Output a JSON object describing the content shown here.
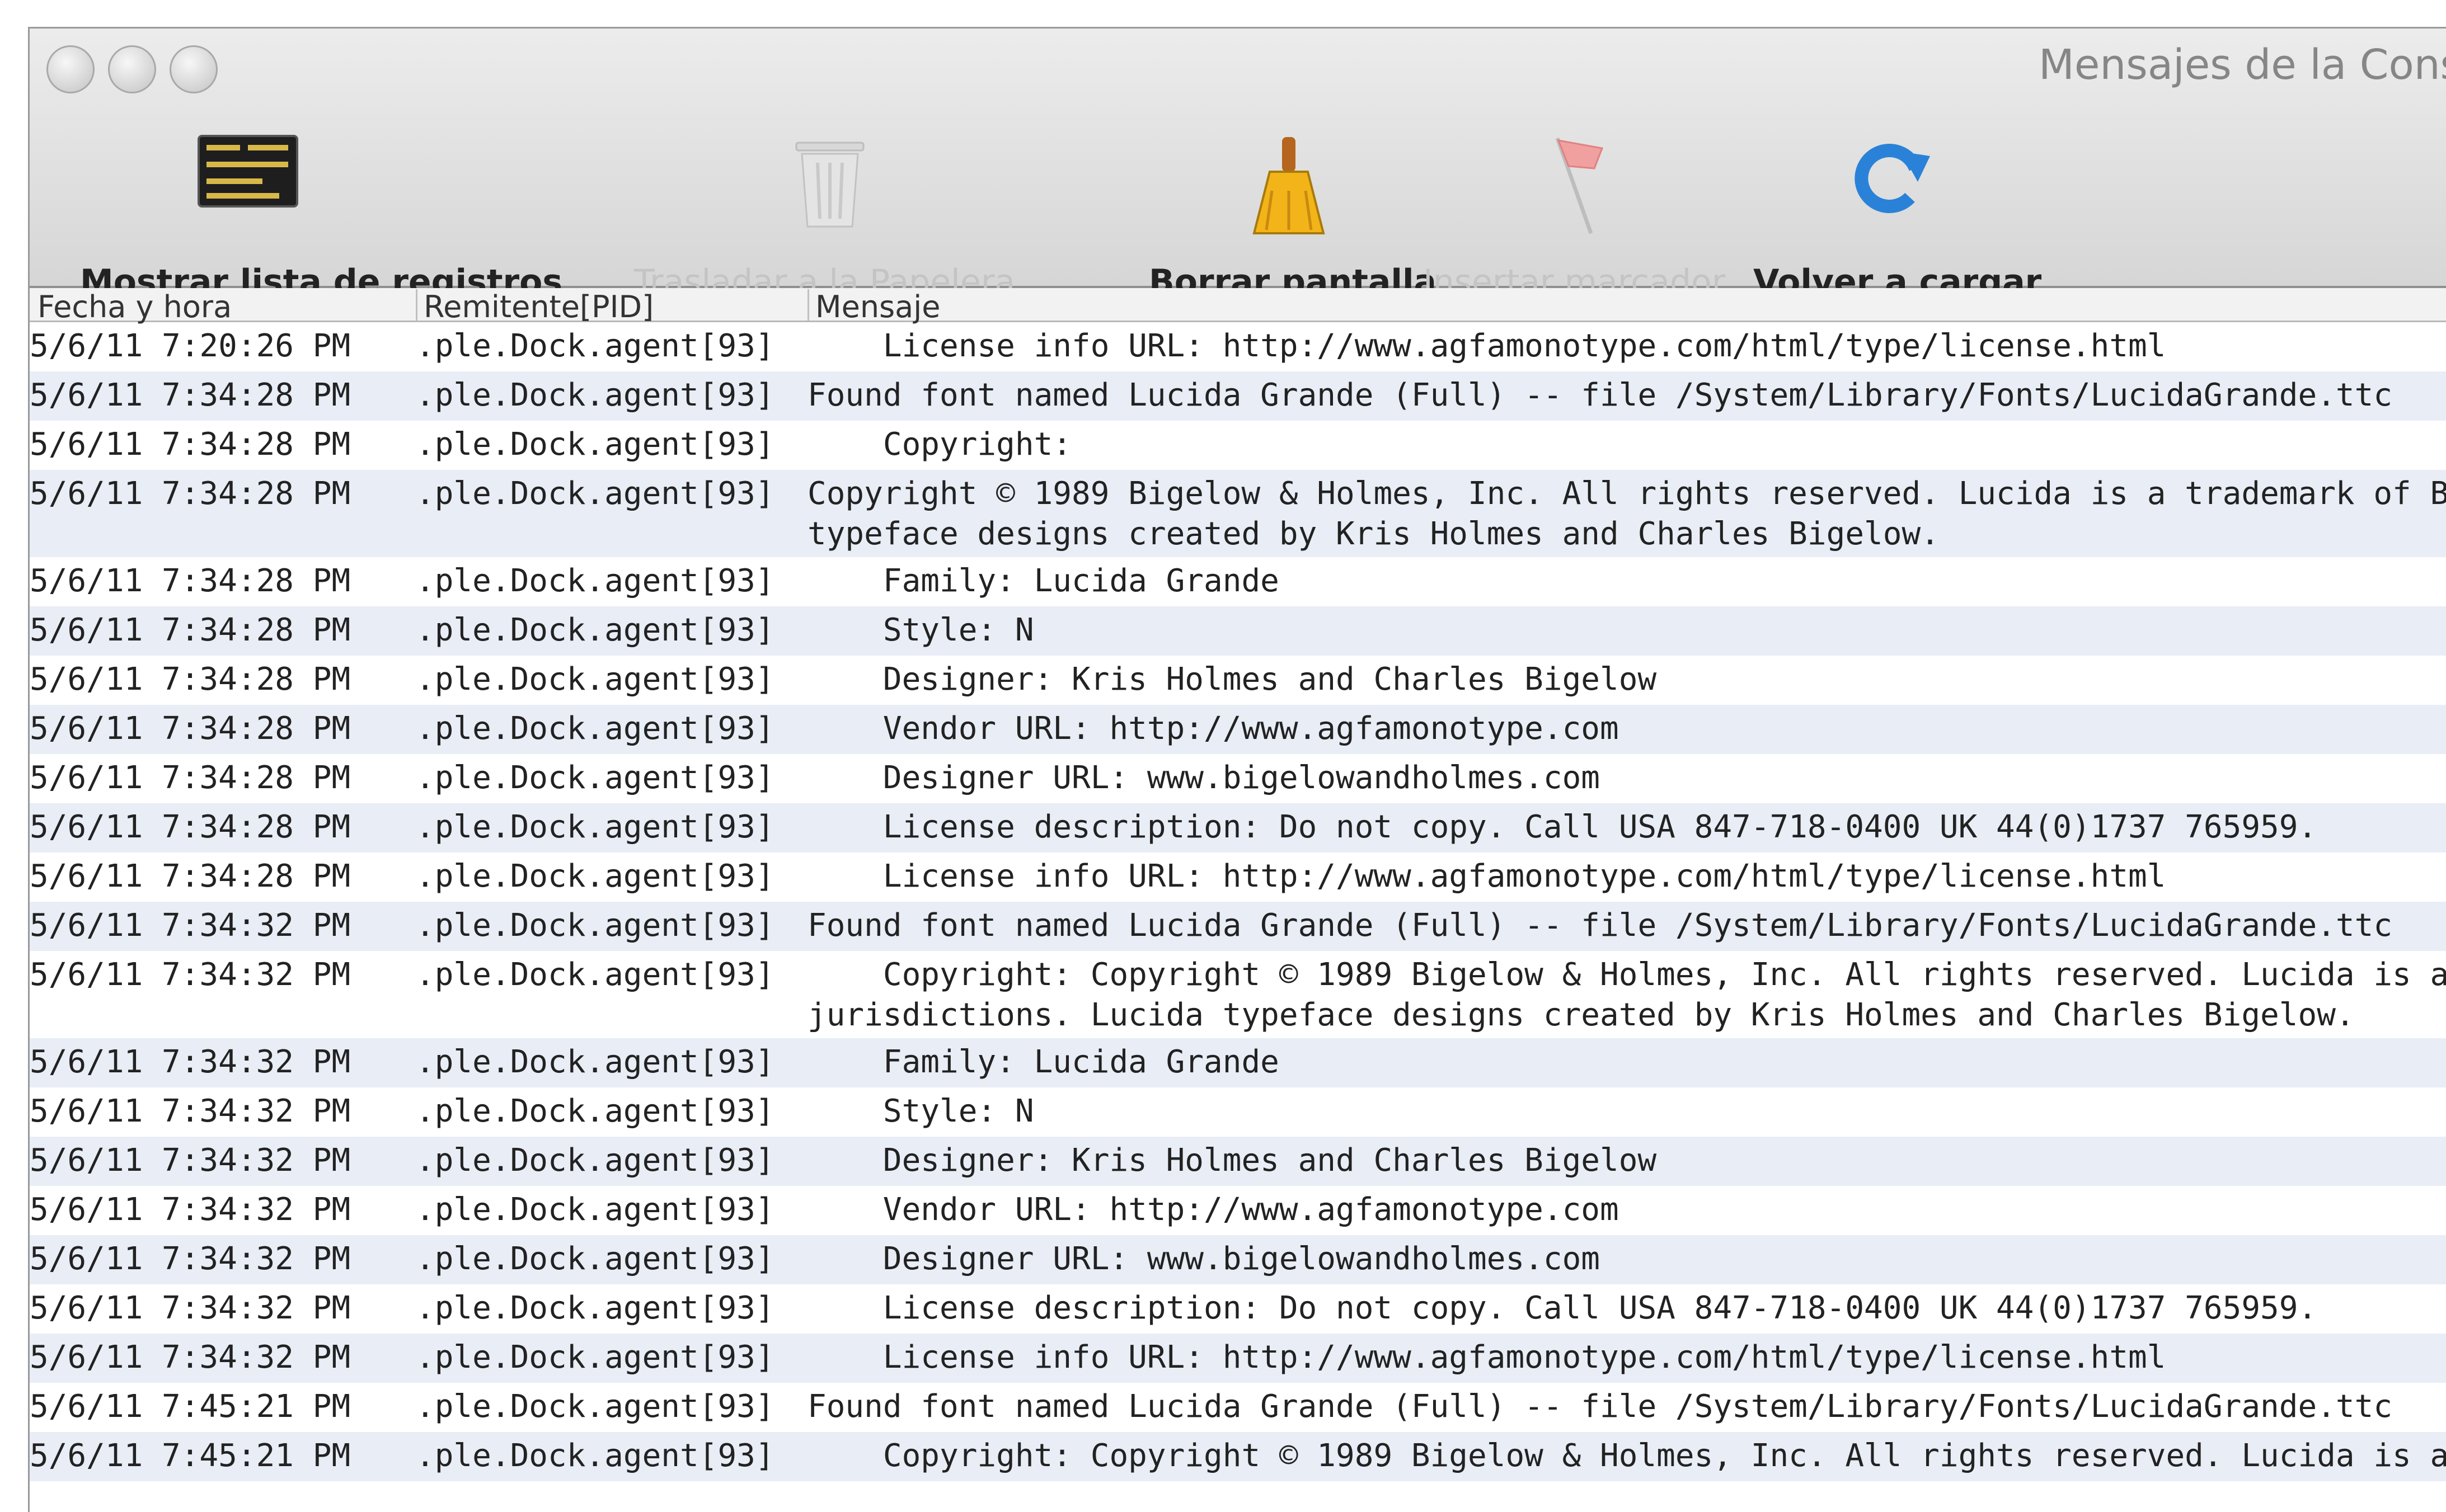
{
  "window": {
    "title": "Mensajes de la Cons"
  },
  "toolbar": {
    "show_logs": "Mostrar lista de registros",
    "move_to_trash": "Trasladar a la Papelera",
    "clear_display": "Borrar pantalla",
    "insert_marker": "Insertar marcador",
    "reload": "Volver a cargar"
  },
  "columns": {
    "date": "Fecha y hora",
    "sender": "Remitente[PID]",
    "message": "Mensaje"
  },
  "rows": [
    {
      "date": "5/6/11 7:20:26 PM",
      "sender": ".ple.Dock.agent[93]",
      "msg": "    License info URL: http://www.agfamonotype.com/html/type/license.html",
      "msg2": ""
    },
    {
      "date": "5/6/11 7:34:28 PM",
      "sender": ".ple.Dock.agent[93]",
      "msg": "Found font named Lucida Grande (Full) -- file /System/Library/Fonts/LucidaGrande.ttc",
      "msg2": ""
    },
    {
      "date": "5/6/11 7:34:28 PM",
      "sender": ".ple.Dock.agent[93]",
      "msg": "    Copyright:",
      "msg2": ""
    },
    {
      "date": "5/6/11 7:34:28 PM",
      "sender": ".ple.Dock.agent[93]",
      "msg": "Copyright © 1989 Bigelow & Holmes, Inc. All rights reserved. Lucida is a trademark of B",
      "msg2": "typeface designs created by Kris Holmes and Charles Bigelow."
    },
    {
      "date": "5/6/11 7:34:28 PM",
      "sender": ".ple.Dock.agent[93]",
      "msg": "    Family: Lucida Grande",
      "msg2": ""
    },
    {
      "date": "5/6/11 7:34:28 PM",
      "sender": ".ple.Dock.agent[93]",
      "msg": "    Style: N",
      "msg2": ""
    },
    {
      "date": "5/6/11 7:34:28 PM",
      "sender": ".ple.Dock.agent[93]",
      "msg": "    Designer: Kris Holmes and Charles Bigelow",
      "msg2": ""
    },
    {
      "date": "5/6/11 7:34:28 PM",
      "sender": ".ple.Dock.agent[93]",
      "msg": "    Vendor URL: http://www.agfamonotype.com",
      "msg2": ""
    },
    {
      "date": "5/6/11 7:34:28 PM",
      "sender": ".ple.Dock.agent[93]",
      "msg": "    Designer URL: www.bigelowandholmes.com",
      "msg2": ""
    },
    {
      "date": "5/6/11 7:34:28 PM",
      "sender": ".ple.Dock.agent[93]",
      "msg": "    License description: Do not copy. Call USA 847-718-0400 UK 44(0)1737 765959.",
      "msg2": ""
    },
    {
      "date": "5/6/11 7:34:28 PM",
      "sender": ".ple.Dock.agent[93]",
      "msg": "    License info URL: http://www.agfamonotype.com/html/type/license.html",
      "msg2": ""
    },
    {
      "date": "5/6/11 7:34:32 PM",
      "sender": ".ple.Dock.agent[93]",
      "msg": "Found font named Lucida Grande (Full) -- file /System/Library/Fonts/LucidaGrande.ttc",
      "msg2": ""
    },
    {
      "date": "5/6/11 7:34:32 PM",
      "sender": ".ple.Dock.agent[93]",
      "msg": "    Copyright: Copyright © 1989 Bigelow & Holmes, Inc. All rights reserved. Lucida is a",
      "msg2": "jurisdictions. Lucida typeface designs created by Kris Holmes and Charles Bigelow."
    },
    {
      "date": "5/6/11 7:34:32 PM",
      "sender": ".ple.Dock.agent[93]",
      "msg": "    Family: Lucida Grande",
      "msg2": ""
    },
    {
      "date": "5/6/11 7:34:32 PM",
      "sender": ".ple.Dock.agent[93]",
      "msg": "    Style: N",
      "msg2": ""
    },
    {
      "date": "5/6/11 7:34:32 PM",
      "sender": ".ple.Dock.agent[93]",
      "msg": "    Designer: Kris Holmes and Charles Bigelow",
      "msg2": ""
    },
    {
      "date": "5/6/11 7:34:32 PM",
      "sender": ".ple.Dock.agent[93]",
      "msg": "    Vendor URL: http://www.agfamonotype.com",
      "msg2": ""
    },
    {
      "date": "5/6/11 7:34:32 PM",
      "sender": ".ple.Dock.agent[93]",
      "msg": "    Designer URL: www.bigelowandholmes.com",
      "msg2": ""
    },
    {
      "date": "5/6/11 7:34:32 PM",
      "sender": ".ple.Dock.agent[93]",
      "msg": "    License description: Do not copy. Call USA 847-718-0400 UK 44(0)1737 765959.",
      "msg2": ""
    },
    {
      "date": "5/6/11 7:34:32 PM",
      "sender": ".ple.Dock.agent[93]",
      "msg": "    License info URL: http://www.agfamonotype.com/html/type/license.html",
      "msg2": ""
    },
    {
      "date": "5/6/11 7:45:21 PM",
      "sender": ".ple.Dock.agent[93]",
      "msg": "Found font named Lucida Grande (Full) -- file /System/Library/Fonts/LucidaGrande.ttc",
      "msg2": ""
    },
    {
      "date": "5/6/11 7:45:21 PM",
      "sender": ".ple.Dock.agent[93]",
      "msg": "    Copyright: Copyright © 1989 Bigelow & Holmes, Inc. All rights reserved. Lucida is a",
      "msg2": ""
    }
  ]
}
